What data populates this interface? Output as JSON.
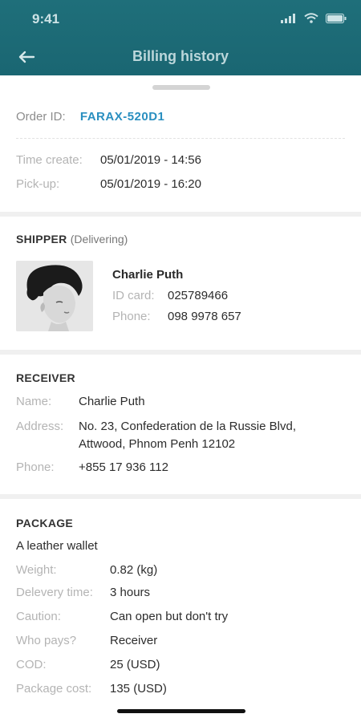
{
  "status_bar": {
    "time": "9:41"
  },
  "header": {
    "title": "Billing history"
  },
  "order": {
    "id_label": "Order ID:",
    "id_value": "FARAX-520D1",
    "time_create_label": "Time create:",
    "time_create_value": "05/01/2019 - 14:56",
    "pickup_label": "Pick-up:",
    "pickup_value": "05/01/2019 - 16:20"
  },
  "shipper": {
    "title": "SHIPPER",
    "status": "(Delivering)",
    "name": "Charlie Puth",
    "id_card_label": "ID card:",
    "id_card_value": "025789466",
    "phone_label": "Phone:",
    "phone_value": "098 9978 657"
  },
  "receiver": {
    "title": "RECEIVER",
    "name_label": "Name:",
    "name_value": "Charlie Puth",
    "address_label": "Address:",
    "address_line1": "No. 23, Confederation de la Russie Blvd,",
    "address_line2": "Attwood, Phnom Penh 12102",
    "phone_label": "Phone:",
    "phone_value": "+855 17 936 112"
  },
  "package": {
    "title": "PACKAGE",
    "description": "A leather wallet",
    "rows": [
      {
        "label": "Weight:",
        "value": "0.82 (kg)"
      },
      {
        "label": "Delevery time:",
        "value": "3 hours"
      },
      {
        "label": "Caution:",
        "value": "Can open but don't try"
      },
      {
        "label": "Who pays?",
        "value": "Receiver"
      },
      {
        "label": "COD:",
        "value": "25 (USD)"
      },
      {
        "label": "Package cost:",
        "value": "135 (USD)"
      }
    ]
  },
  "colors": {
    "header_bg": "#1f6f7a",
    "accent_link": "#2a8fc0",
    "label_gray": "#b4b4b4"
  },
  "icons": [
    "back-arrow-icon",
    "signal-icon",
    "wifi-icon",
    "battery-icon"
  ]
}
